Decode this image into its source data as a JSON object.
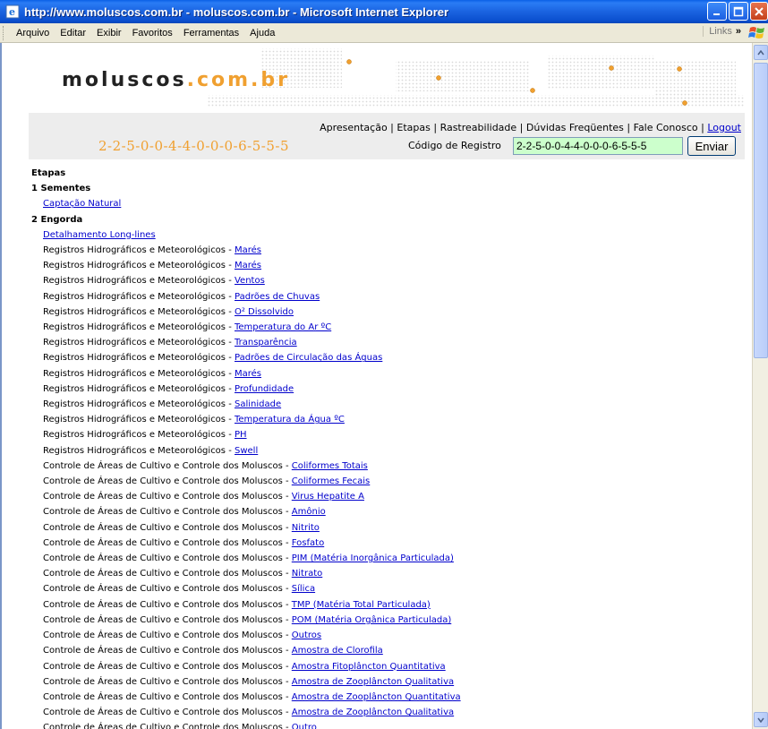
{
  "window": {
    "title": "http://www.moluscos.com.br - moluscos.com.br - Microsoft Internet Explorer"
  },
  "menu": {
    "items": [
      "Arquivo",
      "Editar",
      "Exibir",
      "Favoritos",
      "Ferramentas",
      "Ajuda"
    ],
    "links_label": "Links"
  },
  "site": {
    "logo_main": "moluscos",
    "logo_domain": ".com.br",
    "nav": [
      "Apresentação",
      "Etapas",
      "Rastreabilidade",
      "Dúvidas Freqüentes",
      "Fale Conosco"
    ],
    "logout": "Logout",
    "code_display": "2-2-5-0-0-4-4-0-0-0-6-5-5-5",
    "code_label": "Código de Registro",
    "code_value": "2-2-5-0-0-4-4-0-0-0-6-5-5-5",
    "send_label": "Enviar"
  },
  "content": {
    "title": "Etapas",
    "section1": "1 Sementes",
    "captacao": "Captação Natural",
    "section2": "2 Engorda",
    "detalhamento": "Detalhamento Long-lines",
    "rows": [
      {
        "prefix": "Registros Hidrográficos e Meteorológicos - ",
        "link": "Marés"
      },
      {
        "prefix": "Registros Hidrográficos e Meteorológicos - ",
        "link": "Marés"
      },
      {
        "prefix": "Registros Hidrográficos e Meteorológicos - ",
        "link": "Ventos"
      },
      {
        "prefix": "Registros Hidrográficos e Meteorológicos - ",
        "link": "Padrões de Chuvas"
      },
      {
        "prefix": "Registros Hidrográficos e Meteorológicos - ",
        "link": "O² Dissolvido"
      },
      {
        "prefix": "Registros Hidrográficos e Meteorológicos - ",
        "link": "Temperatura do Ar ºC"
      },
      {
        "prefix": "Registros Hidrográficos e Meteorológicos - ",
        "link": "Transparência"
      },
      {
        "prefix": "Registros Hidrográficos e Meteorológicos - ",
        "link": "Padrões de Circulação das Águas"
      },
      {
        "prefix": "Registros Hidrográficos e Meteorológicos - ",
        "link": "Marés"
      },
      {
        "prefix": "Registros Hidrográficos e Meteorológicos - ",
        "link": "Profundidade"
      },
      {
        "prefix": "Registros Hidrográficos e Meteorológicos - ",
        "link": "Salinidade"
      },
      {
        "prefix": "Registros Hidrográficos e Meteorológicos - ",
        "link": "Temperatura da Água ºC"
      },
      {
        "prefix": "Registros Hidrográficos e Meteorológicos - ",
        "link": "PH"
      },
      {
        "prefix": "Registros Hidrográficos e Meteorológicos - ",
        "link": "Swell"
      },
      {
        "prefix": "Controle de Áreas de Cultivo e Controle dos Moluscos - ",
        "link": "Coliformes Totais"
      },
      {
        "prefix": "Controle de Áreas de Cultivo e Controle dos Moluscos - ",
        "link": "Coliformes Fecais"
      },
      {
        "prefix": "Controle de Áreas de Cultivo e Controle dos Moluscos - ",
        "link": "Virus Hepatite A"
      },
      {
        "prefix": "Controle de Áreas de Cultivo e Controle dos Moluscos - ",
        "link": "Amônio"
      },
      {
        "prefix": "Controle de Áreas de Cultivo e Controle dos Moluscos - ",
        "link": "Nitrito"
      },
      {
        "prefix": "Controle de Áreas de Cultivo e Controle dos Moluscos - ",
        "link": "Fosfato"
      },
      {
        "prefix": "Controle de Áreas de Cultivo e Controle dos Moluscos - ",
        "link": "PIM (Matéria Inorgânica Particulada)"
      },
      {
        "prefix": "Controle de Áreas de Cultivo e Controle dos Moluscos - ",
        "link": "Nitrato"
      },
      {
        "prefix": "Controle de Áreas de Cultivo e Controle dos Moluscos - ",
        "link": "Sílica"
      },
      {
        "prefix": "Controle de Áreas de Cultivo e Controle dos Moluscos - ",
        "link": "TMP (Matéria Total Particulada)"
      },
      {
        "prefix": "Controle de Áreas de Cultivo e Controle dos Moluscos - ",
        "link": "POM (Matéria Orgânica Particulada)"
      },
      {
        "prefix": "Controle de Áreas de Cultivo e Controle dos Moluscos - ",
        "link": "Outros"
      },
      {
        "prefix": "Controle de Áreas de Cultivo e Controle dos Moluscos - ",
        "link": "Amostra de Clorofila"
      },
      {
        "prefix": "Controle de Áreas de Cultivo e Controle dos Moluscos - ",
        "link": "Amostra Fitoplâncton Quantitativa"
      },
      {
        "prefix": "Controle de Áreas de Cultivo e Controle dos Moluscos - ",
        "link": "Amostra de Zooplâncton Qualitativa"
      },
      {
        "prefix": "Controle de Áreas de Cultivo e Controle dos Moluscos - ",
        "link": "Amostra de Zooplâncton Quantitativa"
      },
      {
        "prefix": "Controle de Áreas de Cultivo e Controle dos Moluscos - ",
        "link": "Amostra de Zooplâncton Qualitativa"
      },
      {
        "prefix": "Controle de Áreas de Cultivo e Controle dos Moluscos - ",
        "link": "Outro"
      }
    ]
  },
  "colors": {
    "accent": "#f0a030",
    "link": "#0000cc",
    "input_bg": "#ccffcc"
  }
}
